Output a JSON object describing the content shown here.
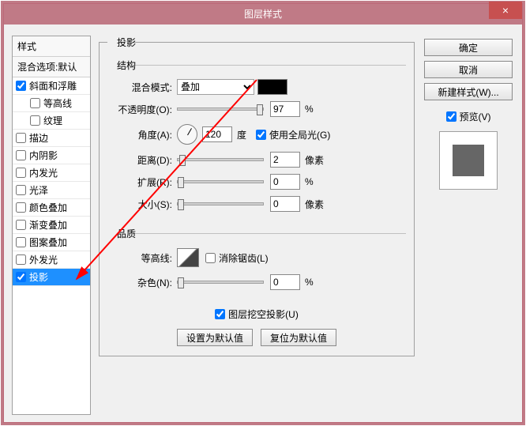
{
  "title": "图层样式",
  "sidebar": {
    "header": "样式",
    "blendHeader": "混合选项:默认",
    "items": [
      {
        "label": "斜面和浮雕",
        "checked": true,
        "indent": false
      },
      {
        "label": "等高线",
        "checked": false,
        "indent": true
      },
      {
        "label": "纹理",
        "checked": false,
        "indent": true
      },
      {
        "label": "描边",
        "checked": false,
        "indent": false
      },
      {
        "label": "内阴影",
        "checked": false,
        "indent": false
      },
      {
        "label": "内发光",
        "checked": false,
        "indent": false
      },
      {
        "label": "光泽",
        "checked": false,
        "indent": false
      },
      {
        "label": "颜色叠加",
        "checked": false,
        "indent": false
      },
      {
        "label": "渐变叠加",
        "checked": false,
        "indent": false
      },
      {
        "label": "图案叠加",
        "checked": false,
        "indent": false
      },
      {
        "label": "外发光",
        "checked": false,
        "indent": false
      },
      {
        "label": "投影",
        "checked": true,
        "indent": false,
        "selected": true
      }
    ]
  },
  "panel": {
    "title": "投影",
    "structure": {
      "legend": "结构",
      "blendModeLabel": "混合模式:",
      "blendModeValue": "叠加",
      "colorSwatch": "#000000",
      "opacityLabel": "不透明度(O):",
      "opacityValue": "97",
      "opacityUnit": "%",
      "angleLabel": "角度(A):",
      "angleValue": "120",
      "angleUnit": "度",
      "globalLightLabel": "使用全局光(G)",
      "globalLightChecked": true,
      "distanceLabel": "距离(D):",
      "distanceValue": "2",
      "distanceUnit": "像素",
      "spreadLabel": "扩展(R):",
      "spreadValue": "0",
      "spreadUnit": "%",
      "sizeLabel": "大小(S):",
      "sizeValue": "0",
      "sizeUnit": "像素"
    },
    "quality": {
      "legend": "品质",
      "contourLabel": "等高线:",
      "antiAliasLabel": "消除锯齿(L)",
      "antiAliasChecked": false,
      "noiseLabel": "杂色(N):",
      "noiseValue": "0",
      "noiseUnit": "%"
    },
    "knockoutLabel": "图层挖空投影(U)",
    "knockoutChecked": true,
    "setDefault": "设置为默认值",
    "resetDefault": "复位为默认值"
  },
  "buttons": {
    "ok": "确定",
    "cancel": "取消",
    "newStyle": "新建样式(W)...",
    "previewLabel": "预览(V)",
    "previewChecked": true
  }
}
